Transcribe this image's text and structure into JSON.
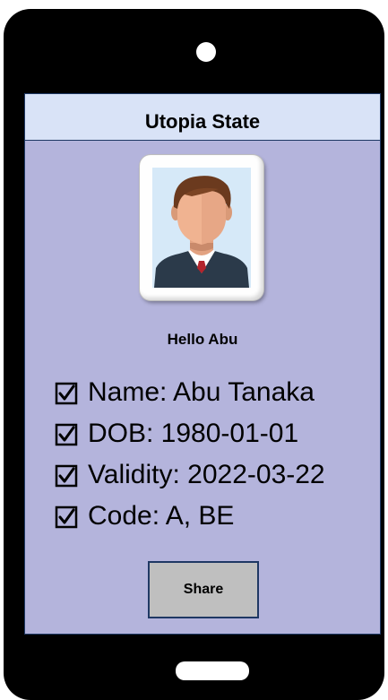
{
  "header": {
    "title": "Utopia State"
  },
  "profile": {
    "greeting": "Hello Abu",
    "avatar_icon": "person-portrait-icon"
  },
  "info": {
    "items": [
      {
        "icon": "checked-box-icon",
        "label": "Name: Abu Tanaka"
      },
      {
        "icon": "checked-box-icon",
        "label": "DOB: 1980-01-01"
      },
      {
        "icon": "checked-box-icon",
        "label": "Validity: 2022-03-22"
      },
      {
        "icon": "checked-box-icon",
        "label": "Code: A, BE"
      }
    ]
  },
  "actions": {
    "share_label": "Share"
  },
  "colors": {
    "phone_body": "#000000",
    "screen_bg": "#b4b4dc",
    "header_bg": "#d9e3f7",
    "border": "#1f3864",
    "button_bg": "#bfbfbf"
  }
}
